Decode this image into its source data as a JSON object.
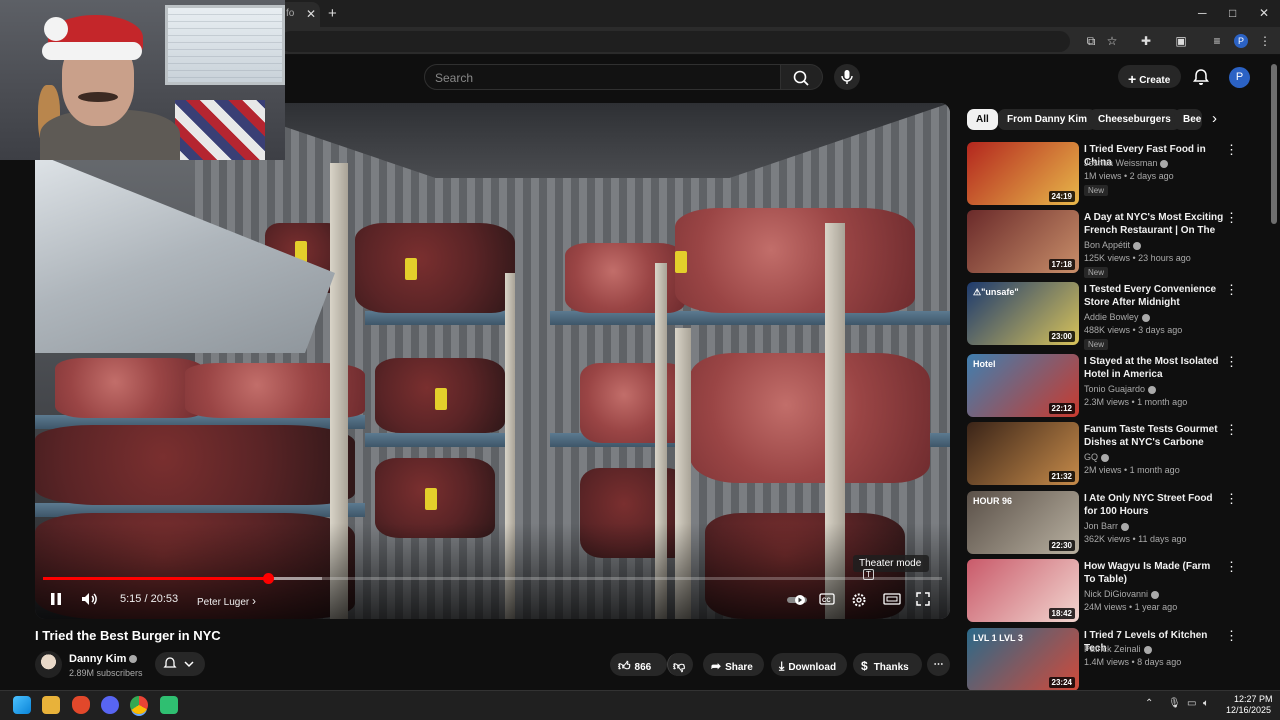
{
  "browser": {
    "tab_title": "fo",
    "new_tab": "+",
    "close_tab": "✕",
    "window_minimize": "─",
    "window_maximize": "□",
    "window_close": "✕",
    "profile_initial": "P"
  },
  "header": {
    "search_placeholder": "Search",
    "create_label": "Create",
    "avatar_initial": "P"
  },
  "player": {
    "time": "5:15 / 20:53",
    "chapter": "Peter Luger",
    "chapter_chevron": "›",
    "progress_fraction": 0.25,
    "buffered_fraction": 0.31,
    "tooltip": "Theater mode",
    "tooltip_key": "T"
  },
  "video": {
    "title": "I Tried the Best Burger in NYC",
    "channel": "Danny Kim",
    "subscribers": "2.89M subscribers",
    "likes": "866",
    "share_label": "Share",
    "download_label": "Download",
    "thanks_label": "Thanks",
    "more": "⋯"
  },
  "chips": [
    "All",
    "From Danny Kim",
    "Cheeseburgers",
    "Bee"
  ],
  "recommendations": [
    {
      "title": "I Tried Every Fast Food in China",
      "channel": "Joshua Weissman",
      "meta": "1M views • 2 days ago",
      "badge": "New",
      "duration": "24:19",
      "colors": [
        "#b3261e",
        "#e8b84a"
      ]
    },
    {
      "title": "A Day at NYC's Most Exciting French Restaurant | On The Lin...",
      "channel": "Bon Appétit",
      "meta": "125K views • 23 hours ago",
      "badge": "New",
      "duration": "17:18",
      "colors": [
        "#6a2a2a",
        "#c98f6a"
      ]
    },
    {
      "title": "I Tested Every Convenience Store After Midnight",
      "channel": "Addie Bowley",
      "meta": "488K views • 3 days ago",
      "badge": "New",
      "duration": "23:00",
      "colors": [
        "#1d3a6e",
        "#d8c35a"
      ]
    },
    {
      "title": "I Stayed at the Most Isolated Hotel in America",
      "channel": "Tonio Guajardo",
      "meta": "2.3M views • 1 month ago",
      "badge": "",
      "duration": "22:12",
      "colors": [
        "#3f7fb0",
        "#c93a2e"
      ]
    },
    {
      "title": "Fanum Taste Tests Gourmet Dishes at NYC's Carbone Priva...",
      "channel": "GQ",
      "meta": "2M views • 1 month ago",
      "badge": "",
      "duration": "21:32",
      "colors": [
        "#3a2418",
        "#c68b4a"
      ]
    },
    {
      "title": "I Ate Only NYC Street Food for 100 Hours",
      "channel": "Jon Barr",
      "meta": "362K views • 11 days ago",
      "badge": "",
      "duration": "22:30",
      "colors": [
        "#5a5048",
        "#b8b0a0"
      ]
    },
    {
      "title": "How Wagyu Is Made (Farm To Table)",
      "channel": "Nick DiGiovanni",
      "meta": "24M views • 1 year ago",
      "badge": "",
      "duration": "18:42",
      "colors": [
        "#c95a6a",
        "#f2d6d0"
      ]
    },
    {
      "title": "I Tried 7 Levels of Kitchen Tech",
      "channel": "Patrick Zeinali",
      "meta": "1.4M views • 8 days ago",
      "badge": "",
      "duration": "23:24",
      "colors": [
        "#2a6a8a",
        "#d24a3a"
      ]
    }
  ],
  "thumb_texts": [
    "",
    "",
    "⚠\"unsafe\"",
    "Hotel",
    "",
    "HOUR 96",
    "",
    "LVL 1   LVL 3"
  ],
  "taskbar": {
    "time": "12:27 PM",
    "date": "12/16/2025"
  }
}
